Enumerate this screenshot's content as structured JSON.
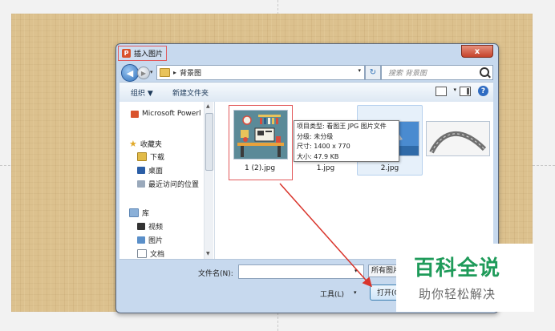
{
  "dialog": {
    "title": "插入图片",
    "close_label": "x"
  },
  "address": {
    "crumb": "背景图",
    "search_placeholder": "搜索 背景图"
  },
  "toolbar": {
    "organize": "组织 ▼",
    "new_folder": "新建文件夹",
    "help": "?"
  },
  "nav": {
    "items": [
      {
        "label": "Microsoft Powerl",
        "icon": "powerpoint-icon"
      },
      {
        "label": "收藏夹",
        "icon": "star-icon"
      },
      {
        "label": "下载",
        "icon": "download-folder-icon"
      },
      {
        "label": "桌面",
        "icon": "desktop-icon"
      },
      {
        "label": "最近访问的位置",
        "icon": "recent-places-icon"
      },
      {
        "label": "库",
        "icon": "library-icon"
      },
      {
        "label": "视频",
        "icon": "video-icon"
      },
      {
        "label": "图片",
        "icon": "pictures-icon"
      },
      {
        "label": "文档",
        "icon": "documents-icon"
      }
    ]
  },
  "files": [
    {
      "name": "1 (2).jpg"
    },
    {
      "name": "1.jpg"
    },
    {
      "name": "2.jpg"
    },
    {
      "name": ""
    }
  ],
  "tooltip": {
    "type": "项目类型: 看图王 JPG 图片文件",
    "rating": "分级: 未分级",
    "dimensions": "尺寸: 1400 x 770",
    "size": "大小: 47.9 KB"
  },
  "bottom": {
    "filename_label": "文件名(N):",
    "filename_value": "",
    "filter": "所有图片",
    "tools": "工具(L)",
    "open": "打开(O)"
  },
  "watermark": {
    "title": "百科全说",
    "subtitle": "助你轻松解决"
  },
  "colors": {
    "highlight_red": "#e2585a",
    "watermark_green": "#1f9b5a",
    "arrow_red": "#d9342b"
  }
}
